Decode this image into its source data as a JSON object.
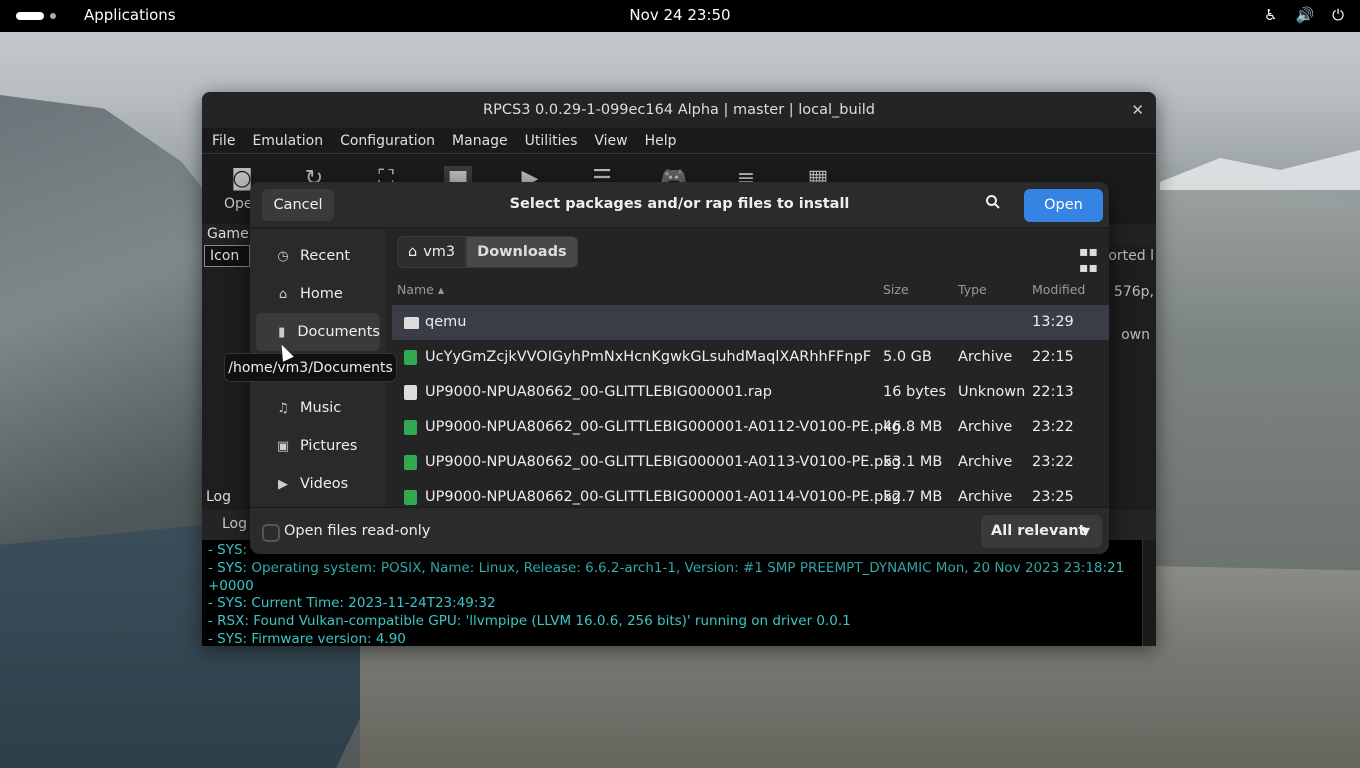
{
  "topbar": {
    "apps_label": "Applications",
    "clock": "Nov 24  23:50",
    "icons": [
      "accessibility-icon",
      "volume-icon",
      "power-icon"
    ]
  },
  "rpcs3": {
    "title": "RPCS3 0.0.29-1-099ec164 Alpha | master | local_build",
    "menu": [
      "File",
      "Emulation",
      "Configuration",
      "Manage",
      "Utilities",
      "View",
      "Help"
    ],
    "toolbar_open_label": "Ope",
    "gamelist_header": "Game",
    "icon_column": "Icon",
    "right_col_header": "orted l",
    "right_text_1": ", 576p,",
    "right_text_2": "own",
    "log_header": "Log",
    "log_tab": "Log",
    "log_lines": [
      "- SYS: Operating system: POSIX, Name: Linux, Release: 6.6.2-arch1-1, Version: #1 SMP PREEMPT_DYNAMIC Mon, 20 Nov 2023 23:18:21 +0000",
      "- SYS: Current Time: 2023-11-24T23:49:32",
      "- RSX: Found Vulkan-compatible GPU: 'llvmpipe (LLVM 16.0.6, 256 bits)' running on driver 0.0.1",
      "- SYS: Firmware version: 4.90"
    ],
    "log_partial_line": "- SYS:"
  },
  "dialog": {
    "cancel_label": "Cancel",
    "title": "Select packages and/or rap files to install",
    "open_label": "Open",
    "sidebar": [
      {
        "label": "Recent",
        "icon": "clock-icon"
      },
      {
        "label": "Home",
        "icon": "home-icon"
      },
      {
        "label": "Documents",
        "icon": "document-icon"
      },
      {
        "label": "Music",
        "icon": "music-icon"
      },
      {
        "label": "Pictures",
        "icon": "picture-icon"
      },
      {
        "label": "Videos",
        "icon": "video-icon"
      }
    ],
    "path": {
      "home": "vm3",
      "current": "Downloads"
    },
    "columns": {
      "name": "Name",
      "size": "Size",
      "type": "Type",
      "modified": "Modified"
    },
    "files": [
      {
        "name": "qemu",
        "size": "",
        "type": "",
        "modified": "13:29",
        "kind": "folder"
      },
      {
        "name": "UcYyGmZcjkVVOIGyhPmNxHcnKgwkGLsuhdMaqlXARhhFFnpFDuosv",
        "size": "5.0 GB",
        "type": "Archive",
        "modified": "22:15",
        "kind": "archive"
      },
      {
        "name": "UP9000-NPUA80662_00-GLITTLEBIG000001.rap",
        "size": "16 bytes",
        "type": "Unknown",
        "modified": "22:13",
        "kind": "unknown"
      },
      {
        "name": "UP9000-NPUA80662_00-GLITTLEBIG000001-A0112-V0100-PE.pkg",
        "size": "46.8 MB",
        "type": "Archive",
        "modified": "23:22",
        "kind": "archive"
      },
      {
        "name": "UP9000-NPUA80662_00-GLITTLEBIG000001-A0113-V0100-PE.pkg",
        "size": "53.1 MB",
        "type": "Archive",
        "modified": "23:22",
        "kind": "archive"
      },
      {
        "name": "UP9000-NPUA80662_00-GLITTLEBIG000001-A0114-V0100-PE.pkg",
        "size": "52.7 MB",
        "type": "Archive",
        "modified": "23:25",
        "kind": "archive"
      }
    ],
    "readonly_label": "Open files read-only",
    "filter_label": "All relevant"
  },
  "tooltip": "/home/vm3/Documents"
}
